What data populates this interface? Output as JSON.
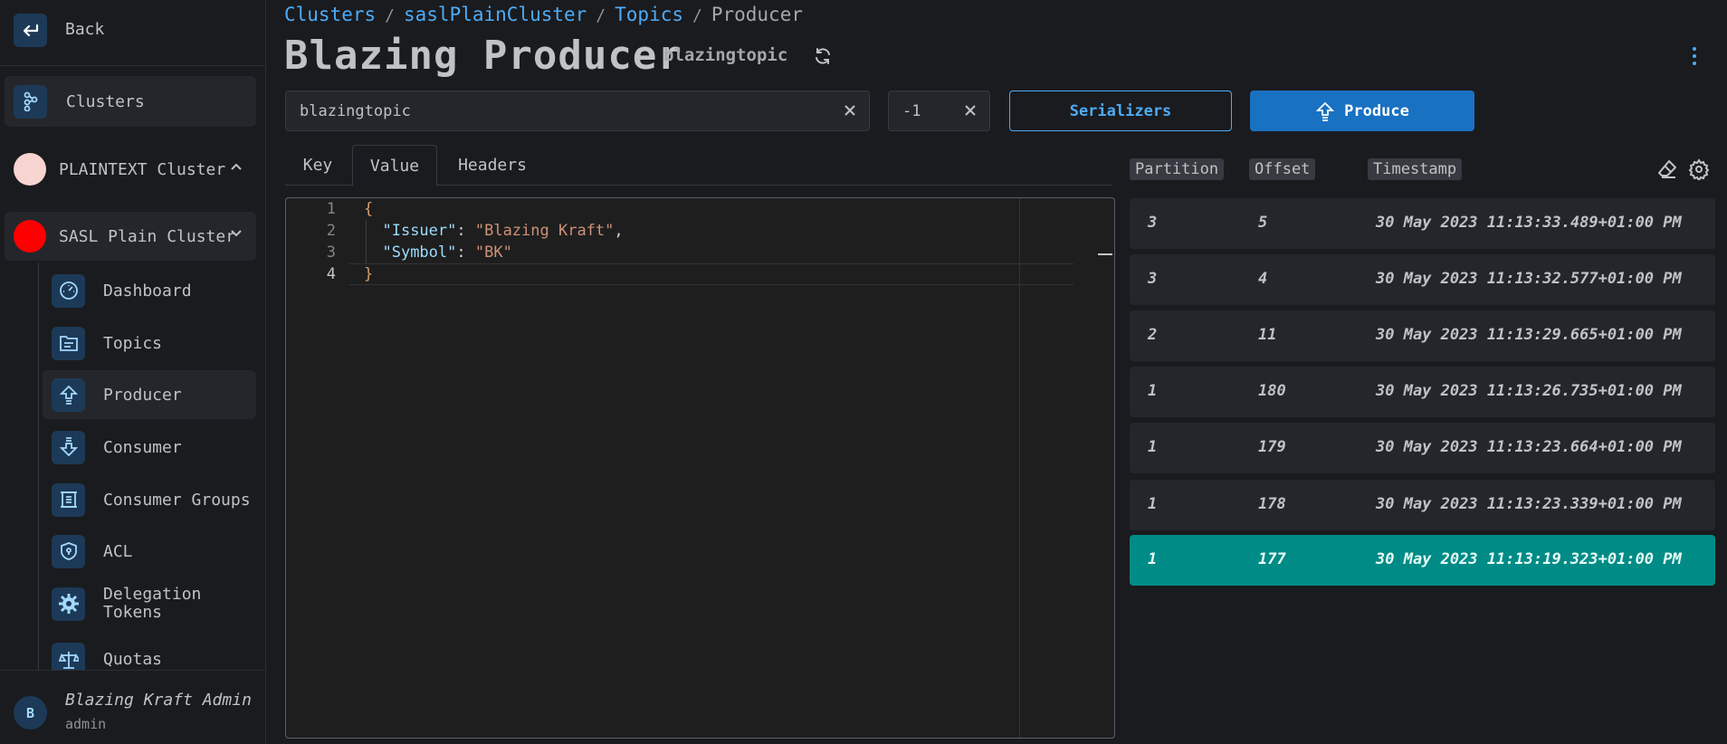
{
  "sidebar": {
    "back_label": "Back",
    "clusters_label": "Clusters",
    "clusters": [
      {
        "label": "PLAINTEXT Cluster",
        "color": "#f8d4d0"
      },
      {
        "label": "SASL Plain Cluster",
        "color": "#ff0000"
      }
    ],
    "items": [
      {
        "label": "Dashboard",
        "icon": "dashboard-gauge-icon"
      },
      {
        "label": "Topics",
        "icon": "topics-folder-icon"
      },
      {
        "label": "Producer",
        "icon": "producer-upload-icon"
      },
      {
        "label": "Consumer",
        "icon": "consumer-download-icon"
      },
      {
        "label": "Consumer Groups",
        "icon": "consumer-groups-icon"
      },
      {
        "label": "ACL",
        "icon": "shield-icon"
      },
      {
        "label": "Delegation Tokens",
        "icon": "gear-badge-icon"
      },
      {
        "label": "Quotas",
        "icon": "scale-icon"
      }
    ],
    "user": {
      "initial": "B",
      "name": "Blazing Kraft Admin",
      "role": "admin"
    }
  },
  "breadcrumb": [
    "Clusters",
    "saslPlainCluster",
    "Topics",
    "Producer"
  ],
  "header": {
    "title": "Blazing Producer",
    "subtitle": "blazingtopic"
  },
  "form": {
    "topic_value": "blazingtopic",
    "partition_value": "-1",
    "serializers_label": "Serializers",
    "produce_label": "Produce"
  },
  "tabs": [
    "Key",
    "Value",
    "Headers"
  ],
  "editor": {
    "line_numbers": [
      "1",
      "2",
      "3",
      "4"
    ],
    "open_brace": "{",
    "close_brace": "}",
    "fields": [
      {
        "key": "\"Issuer\"",
        "value": "\"Blazing Kraft\"",
        "trail": ","
      },
      {
        "key": "\"Symbol\"",
        "value": "\"BK\"",
        "trail": ""
      }
    ]
  },
  "table": {
    "headers": [
      "Partition",
      "Offset",
      "Timestamp"
    ],
    "rows": [
      {
        "partition": "3",
        "offset": "5",
        "timestamp": "30 May 2023 11:13:33.489+01:00 PM"
      },
      {
        "partition": "3",
        "offset": "4",
        "timestamp": "30 May 2023 11:13:32.577+01:00 PM"
      },
      {
        "partition": "2",
        "offset": "11",
        "timestamp": "30 May 2023 11:13:29.665+01:00 PM"
      },
      {
        "partition": "1",
        "offset": "180",
        "timestamp": "30 May 2023 11:13:26.735+01:00 PM"
      },
      {
        "partition": "1",
        "offset": "179",
        "timestamp": "30 May 2023 11:13:23.664+01:00 PM"
      },
      {
        "partition": "1",
        "offset": "178",
        "timestamp": "30 May 2023 11:13:23.339+01:00 PM"
      },
      {
        "partition": "1",
        "offset": "177",
        "timestamp": "30 May 2023 11:13:19.323+01:00 PM"
      }
    ]
  },
  "colors": {
    "accent": "#4dabf7",
    "primary_button": "#1971c2",
    "selected_row": "#008b87"
  }
}
